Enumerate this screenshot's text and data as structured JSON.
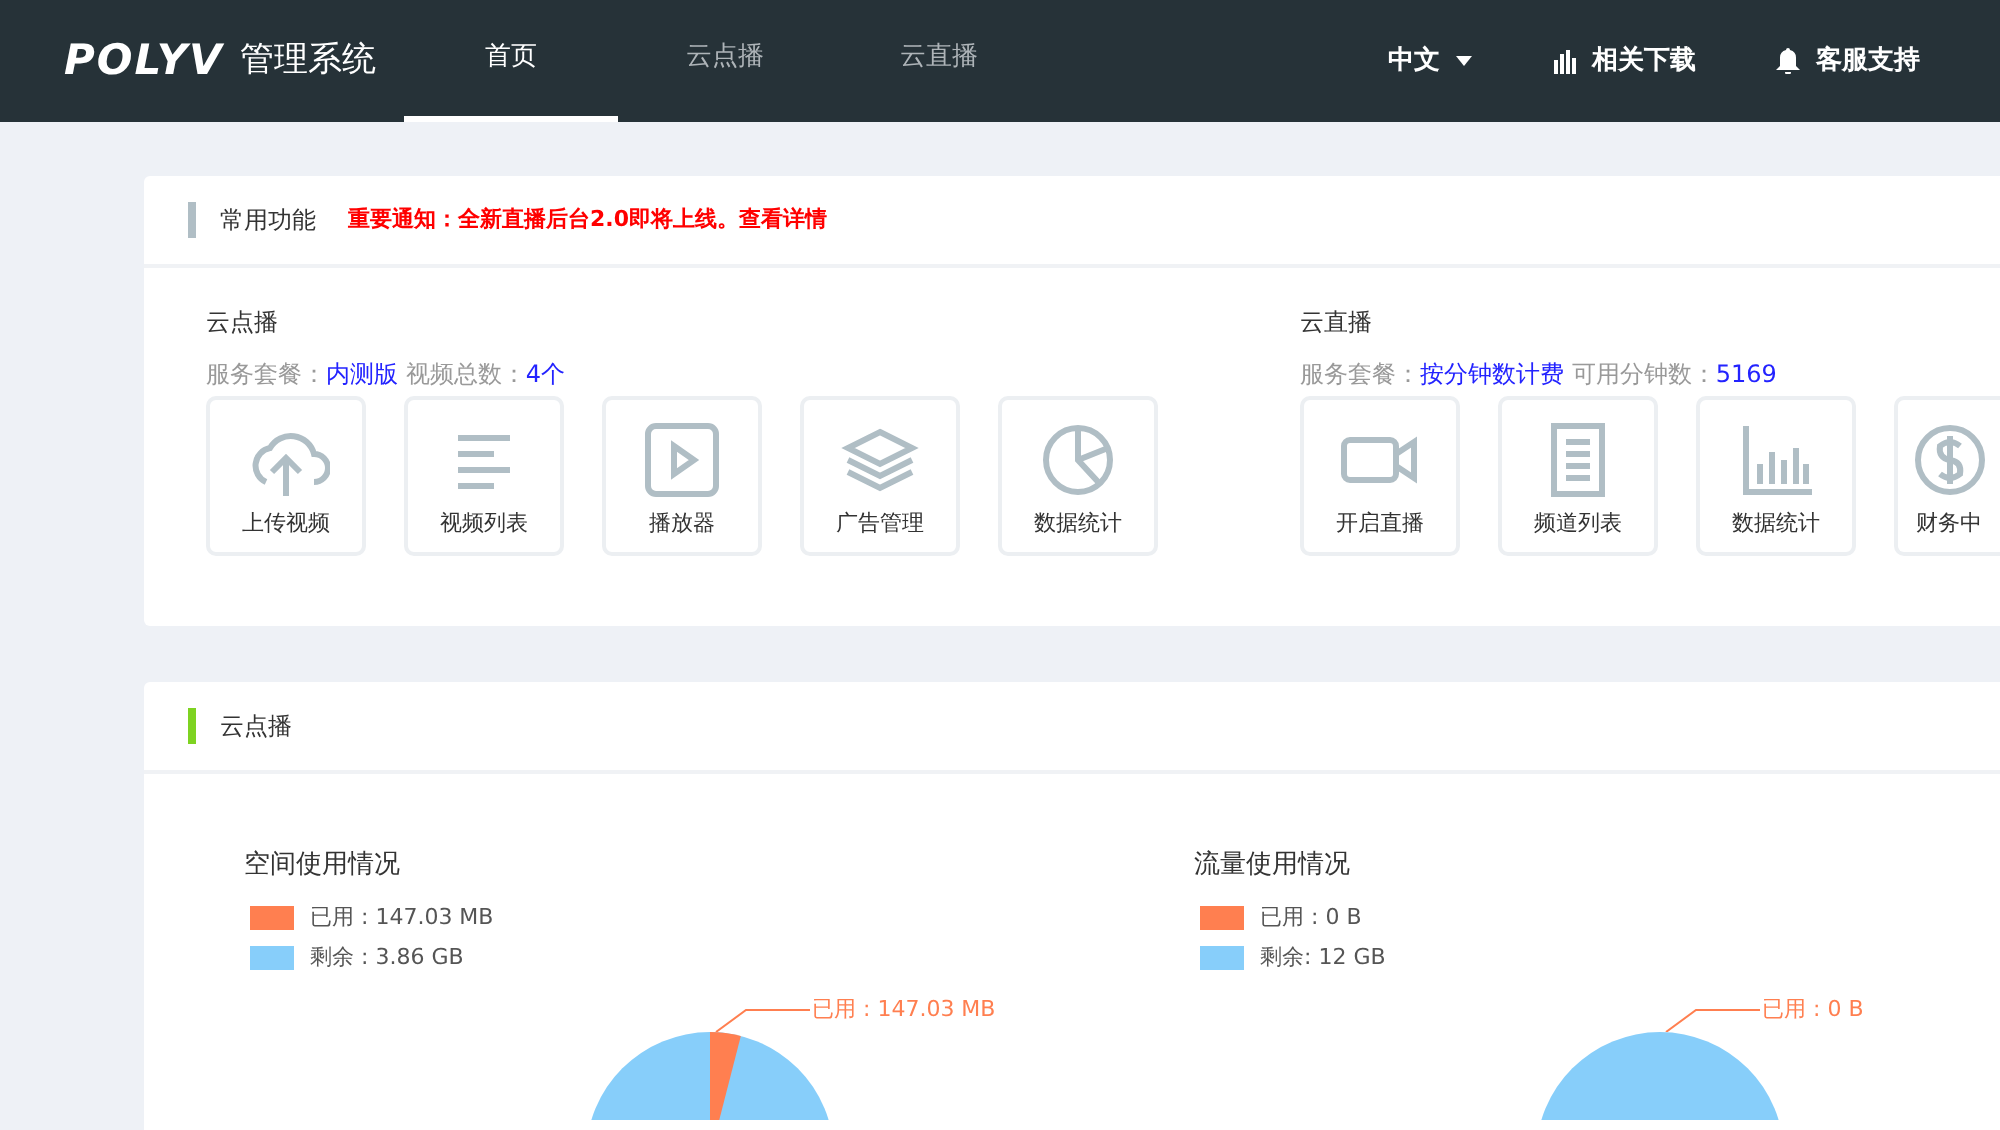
{
  "nav": {
    "logo": "POLYV",
    "system_name": "管理系统",
    "items": [
      {
        "label": "首页",
        "selected": true
      },
      {
        "label": "云点播",
        "selected": false
      },
      {
        "label": "云直播",
        "selected": false
      }
    ],
    "language": "中文",
    "links": [
      {
        "label": "相关下载",
        "kind": "chart"
      },
      {
        "label": "客服支持",
        "kind": "bell"
      }
    ]
  },
  "quick_panel": {
    "title": "常用功能",
    "notice": "重要通知：全新直播后台2.0即将上线。查看详情",
    "sections": [
      {
        "title": "云点播",
        "plan_label": "服务套餐：",
        "plan": "内测版",
        "count_label": "视频总数：",
        "count": "4个",
        "tiles": [
          {
            "label": "上传视频",
            "kind": "upload"
          },
          {
            "label": "视频列表",
            "kind": "list"
          },
          {
            "label": "播放器",
            "kind": "player"
          },
          {
            "label": "广告管理",
            "kind": "ads"
          },
          {
            "label": "数据统计",
            "kind": "stats"
          }
        ]
      },
      {
        "title": "云直播",
        "plan_label": "服务套餐：",
        "plan": "按分钟数计费",
        "count_label": "可用分钟数：",
        "count": "5169",
        "tiles": [
          {
            "label": "开启直播",
            "kind": "live"
          },
          {
            "label": "频道列表",
            "kind": "channels"
          },
          {
            "label": "数据统计",
            "kind": "livestats"
          },
          {
            "label": "财务中",
            "kind": "finance"
          }
        ]
      }
    ]
  },
  "usage_panel": {
    "title": "云点播",
    "charts": [
      {
        "title": "空间使用情况",
        "legend": [
          {
            "label": "已用 : 147.03 MB",
            "color": "#ff7f50"
          },
          {
            "label": "剩余 : 3.86 GB",
            "color": "#87cefa"
          }
        ],
        "callout": "已用 : 147.03 MB"
      },
      {
        "title": "流量使用情况",
        "legend": [
          {
            "label": "已用 : 0 B",
            "color": "#ff7f50"
          },
          {
            "label": "剩余: 12 GB",
            "color": "#87cefa"
          }
        ],
        "callout": "已用 : 0 B"
      }
    ]
  }
}
